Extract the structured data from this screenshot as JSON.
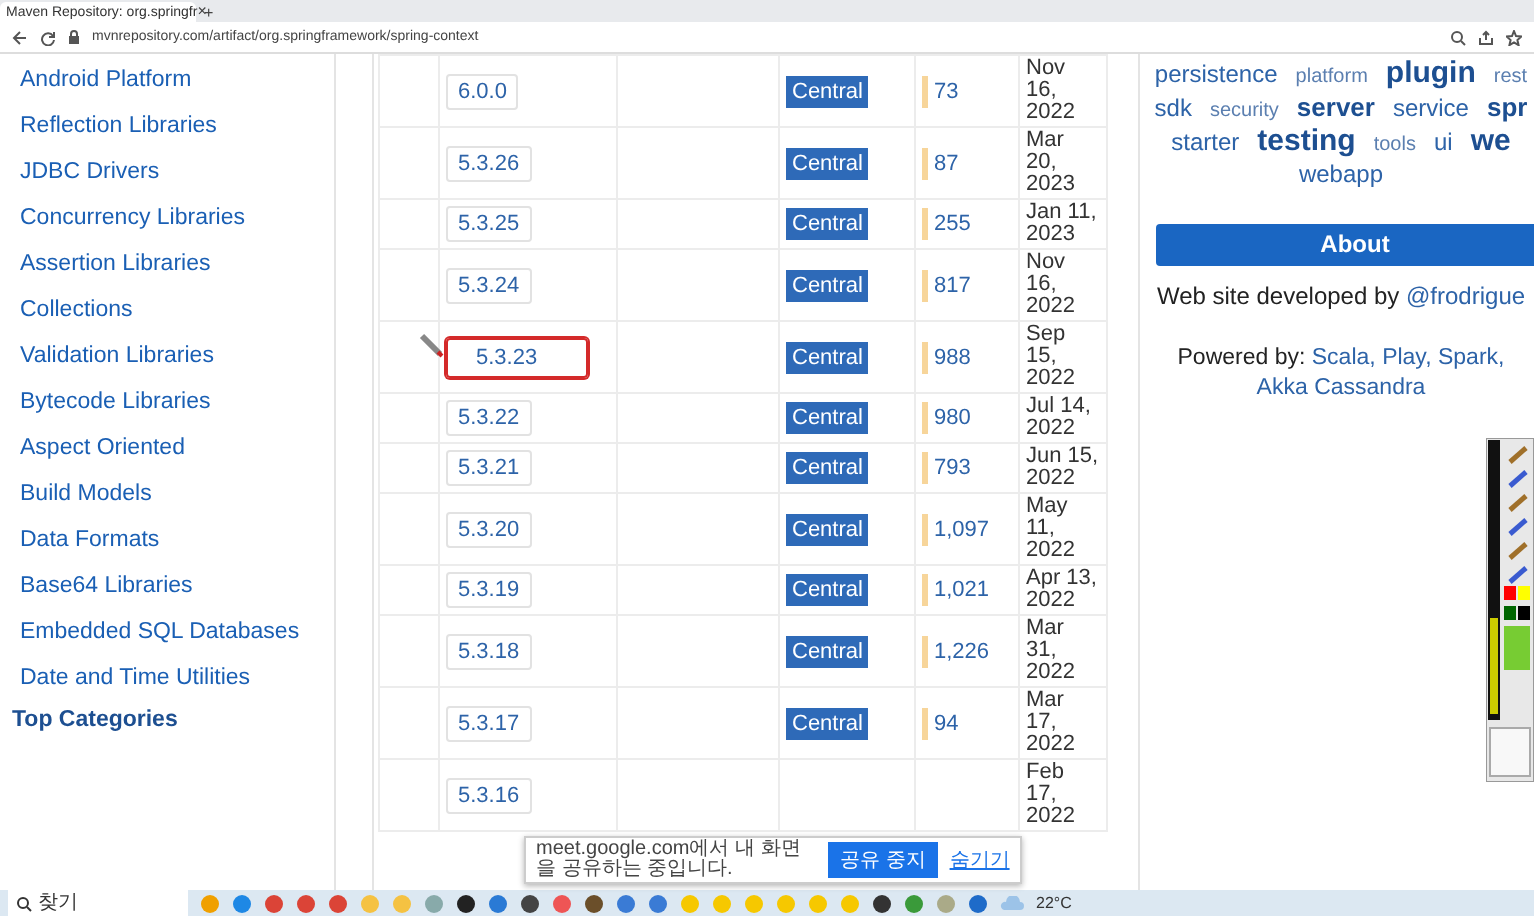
{
  "browser": {
    "tab": {
      "title": "Maven Repository: org.springfr",
      "close": "×"
    },
    "new_tab": "+",
    "url": "mvnrepository.com/artifact/org.springframework/spring-context"
  },
  "sidebar": {
    "items": [
      "Android Platform",
      "Reflection Libraries",
      "JDBC Drivers",
      "Concurrency Libraries",
      "Assertion Libraries",
      "Collections",
      "Validation Libraries",
      "Bytecode Libraries",
      "Aspect Oriented",
      "Build Models",
      "Data Formats",
      "Base64 Libraries",
      "Embedded SQL Databases",
      "Date and Time Utilities"
    ],
    "heading": "Top Categories"
  },
  "versions": [
    {
      "version": "6.0.0",
      "repository": "Central",
      "usages": "73",
      "date": "Nov 16, 2022",
      "highlighted": false
    },
    {
      "version": "5.3.26",
      "repository": "Central",
      "usages": "87",
      "date": "Mar 20, 2023",
      "highlighted": false
    },
    {
      "version": "5.3.25",
      "repository": "Central",
      "usages": "255",
      "date": "Jan 11, 2023",
      "highlighted": false
    },
    {
      "version": "5.3.24",
      "repository": "Central",
      "usages": "817",
      "date": "Nov 16, 2022",
      "highlighted": false
    },
    {
      "version": "5.3.23",
      "repository": "Central",
      "usages": "988",
      "date": "Sep 15, 2022",
      "highlighted": true
    },
    {
      "version": "5.3.22",
      "repository": "Central",
      "usages": "980",
      "date": "Jul 14, 2022",
      "highlighted": false
    },
    {
      "version": "5.3.21",
      "repository": "Central",
      "usages": "793",
      "date": "Jun 15, 2022",
      "highlighted": false
    },
    {
      "version": "5.3.20",
      "repository": "Central",
      "usages": "1,097",
      "date": "May 11, 2022",
      "highlighted": false
    },
    {
      "version": "5.3.19",
      "repository": "Central",
      "usages": "1,021",
      "date": "Apr 13, 2022",
      "highlighted": false
    },
    {
      "version": "5.3.18",
      "repository": "Central",
      "usages": "1,226",
      "date": "Mar 31, 2022",
      "highlighted": false
    },
    {
      "version": "5.3.17",
      "repository": "Central",
      "usages": "94",
      "date": "Mar 17, 2022",
      "highlighted": false
    },
    {
      "version": "5.3.16",
      "date": "Feb 17, 2022",
      "highlighted": false
    }
  ],
  "tags": [
    {
      "label": "persistence",
      "kind": "normal"
    },
    {
      "label": "platform",
      "kind": "small"
    },
    {
      "label": "plugin",
      "kind": "large"
    },
    {
      "label": "rest",
      "kind": "small"
    },
    {
      "label": "sdk",
      "kind": "normal"
    },
    {
      "label": "security",
      "kind": "small"
    },
    {
      "label": "server",
      "kind": "bold"
    },
    {
      "label": "service",
      "kind": "normal"
    },
    {
      "label": "spr",
      "kind": "bold"
    },
    {
      "label": "starter",
      "kind": "normal"
    },
    {
      "label": "testing",
      "kind": "large"
    },
    {
      "label": "tools",
      "kind": "small"
    },
    {
      "label": "ui",
      "kind": "normal"
    },
    {
      "label": "we",
      "kind": "large"
    },
    {
      "label": "webapp",
      "kind": "normal"
    }
  ],
  "about": {
    "heading": "About",
    "developed_text": "Web site developed by",
    "developer_link": "@frodrigue",
    "powered_text": "Powered by:",
    "powered_links": [
      "Scala,",
      "Play,",
      "Spark,",
      "Akka",
      "Cassandra"
    ]
  },
  "share_bar": {
    "message": "meet.google.com에서 내 화면을 공유하는 중입니다.",
    "stop_button": "공유 중지",
    "hide_link": "숨기기"
  },
  "taskbar": {
    "search": "찾기",
    "weather": "22°C"
  }
}
